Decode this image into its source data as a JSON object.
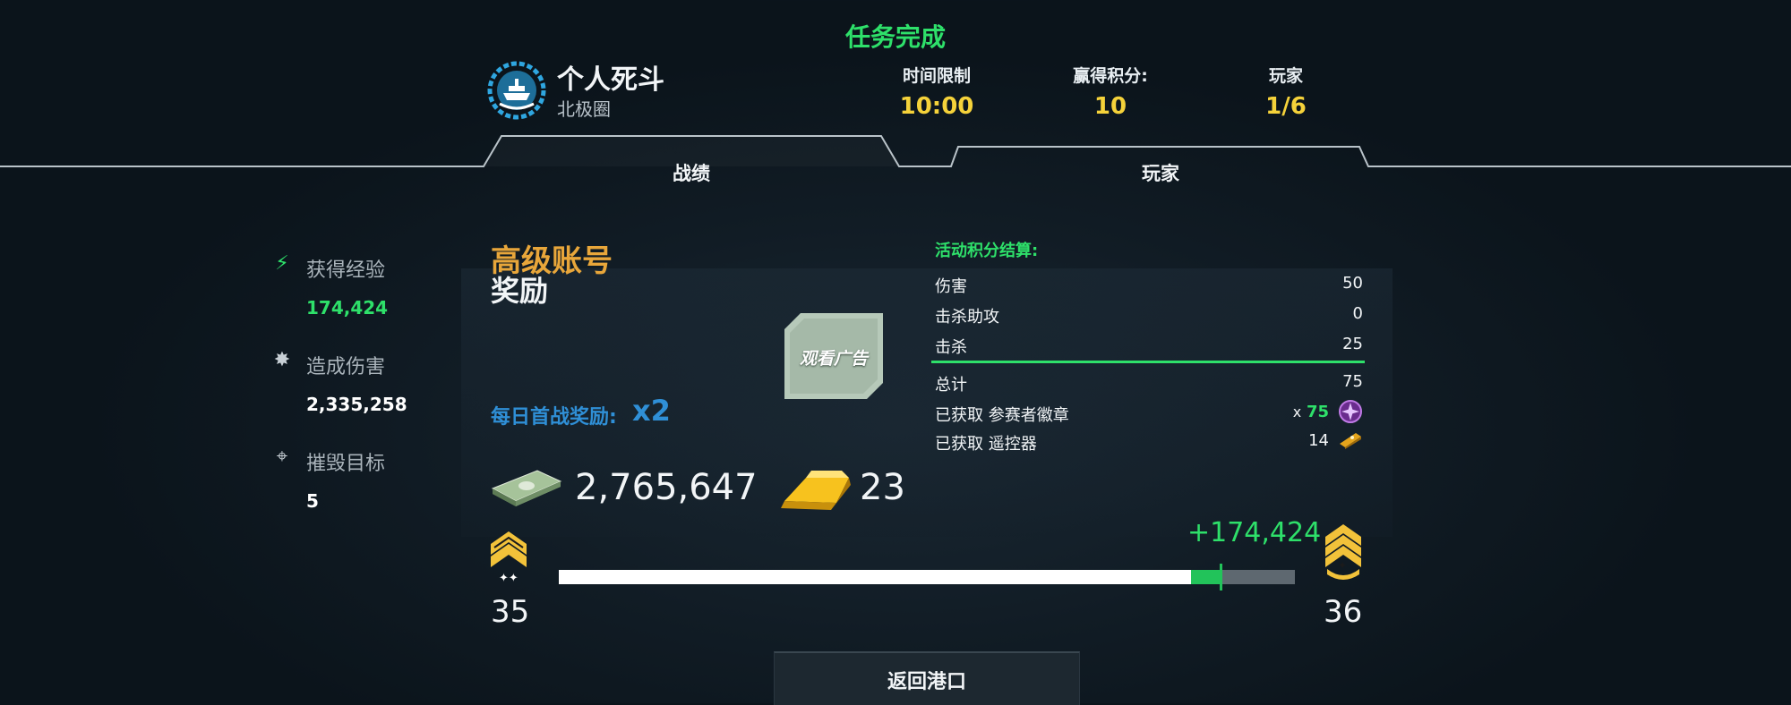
{
  "header": {
    "status": "任务完成",
    "mode_title": "个人死斗",
    "map_name": "北极圈",
    "stats": [
      {
        "label": "时间限制",
        "value": "10:00"
      },
      {
        "label": "赢得积分:",
        "value": "10"
      },
      {
        "label": "玩家",
        "value": "1/6"
      }
    ]
  },
  "tabs": [
    {
      "label": "战绩",
      "active": true
    },
    {
      "label": "玩家",
      "active": false
    }
  ],
  "side_stats": [
    {
      "label": "获得经验",
      "value": "174,424",
      "icon": "lightning-icon",
      "value_color": "#2ee06a"
    },
    {
      "label": "造成伤害",
      "value": "2,335,258",
      "icon": "explosion-icon",
      "value_color": "#ffffff"
    },
    {
      "label": "摧毁目标",
      "value": "5",
      "icon": "crosshair-icon",
      "value_color": "#ffffff"
    }
  ],
  "rewards": {
    "premium_label": "高级账号",
    "rewards_label": "奖励",
    "watch_ad_label": "观看广告",
    "daily_bonus_label": "每日首战奖励:",
    "daily_bonus_multiplier": "x2",
    "cash": "2,765,647",
    "gold": "23"
  },
  "event_points": {
    "title": "活动积分结算:",
    "rows": [
      {
        "label": "伤害",
        "value": "50"
      },
      {
        "label": "击杀助攻",
        "value": "0"
      },
      {
        "label": "击杀",
        "value": "25"
      }
    ],
    "total": {
      "label": "总计",
      "value": "75"
    },
    "obtained": [
      {
        "label": "已获取 参赛者徽章",
        "prefix": "x",
        "value": "75",
        "icon": "badge-icon"
      },
      {
        "label": "已获取 遥控器",
        "prefix": "",
        "value": "14",
        "icon": "remote-icon"
      }
    ]
  },
  "progress": {
    "xp_gain": "+174,424",
    "current_rank": "35",
    "next_rank": "36",
    "progress_fraction": 0.9
  },
  "footer": {
    "return_label": "返回港口"
  },
  "colors": {
    "accent_green": "#2ee06a",
    "gold": "#f5d23a",
    "premium": "#e8a63a",
    "bonus_blue": "#2f8fd6"
  }
}
